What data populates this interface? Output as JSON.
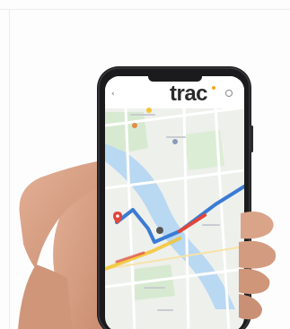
{
  "app": {
    "logo_text": "trac",
    "back_icon": "back-arrow-icon",
    "menu_icon": "menu-icon"
  },
  "colors": {
    "logo": "#2b2b2b",
    "logo_accent": "#f5a623",
    "route_blue": "#3a7bd5",
    "route_traffic_red": "#e0453a",
    "route_traffic_yellow": "#f3c431",
    "river": "#b9d8f2",
    "park": "#d7ead1",
    "map_base": "#eef0ec",
    "skin": "#d9a488",
    "phone_body": "#1b1b1d"
  },
  "map": {
    "markers": [
      "location-pin-icon",
      "map-point-icon",
      "map-point-icon",
      "map-point-icon"
    ]
  }
}
